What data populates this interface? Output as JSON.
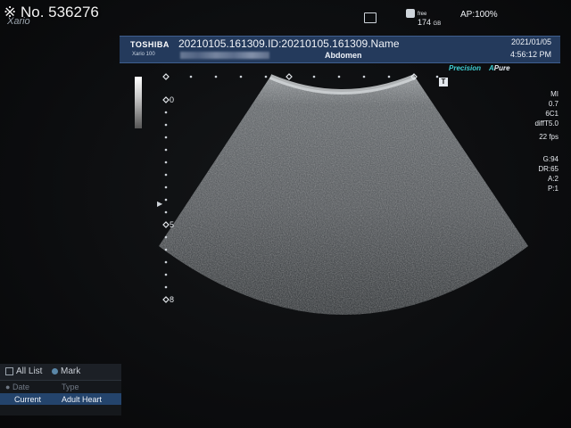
{
  "photo_number": "※ No. 536276",
  "top_left_logo": "Xario",
  "status": {
    "storage_free_label": "free",
    "storage_value": "174",
    "storage_unit": "GB",
    "ap": "AP:100%"
  },
  "header": {
    "brand": "TOSHIBA",
    "model": "Xario 100",
    "id_line": "20210105.161309.ID:20210105.161309.Name",
    "region": "Abdomen",
    "date": "2021/01/05",
    "time": "4:56:12 PM"
  },
  "modes": {
    "precision": "Precision",
    "apure_a": "A",
    "apure_rest": "Pure"
  },
  "depth_labels": {
    "d0": "0",
    "d5": "5",
    "d8": "8"
  },
  "params": {
    "mi_label": "MI",
    "mi_value": "0.7",
    "probe": "6C1",
    "preset": "diffT5.0",
    "fps": "22 fps",
    "gain": "G:94",
    "dr": "DR:65",
    "a": "A:2",
    "p": "P:1"
  },
  "t_marker": "T",
  "list_panel": {
    "tab_all": "All List",
    "tab_mark": "Mark",
    "col_date": "Date",
    "col_type": "Type",
    "row_date": "Current",
    "row_type": "Adult Heart"
  },
  "colors": {
    "header_bg": "#243a5c",
    "accent_cyan": "#3fd0d4",
    "list_selected": "#24446c"
  }
}
